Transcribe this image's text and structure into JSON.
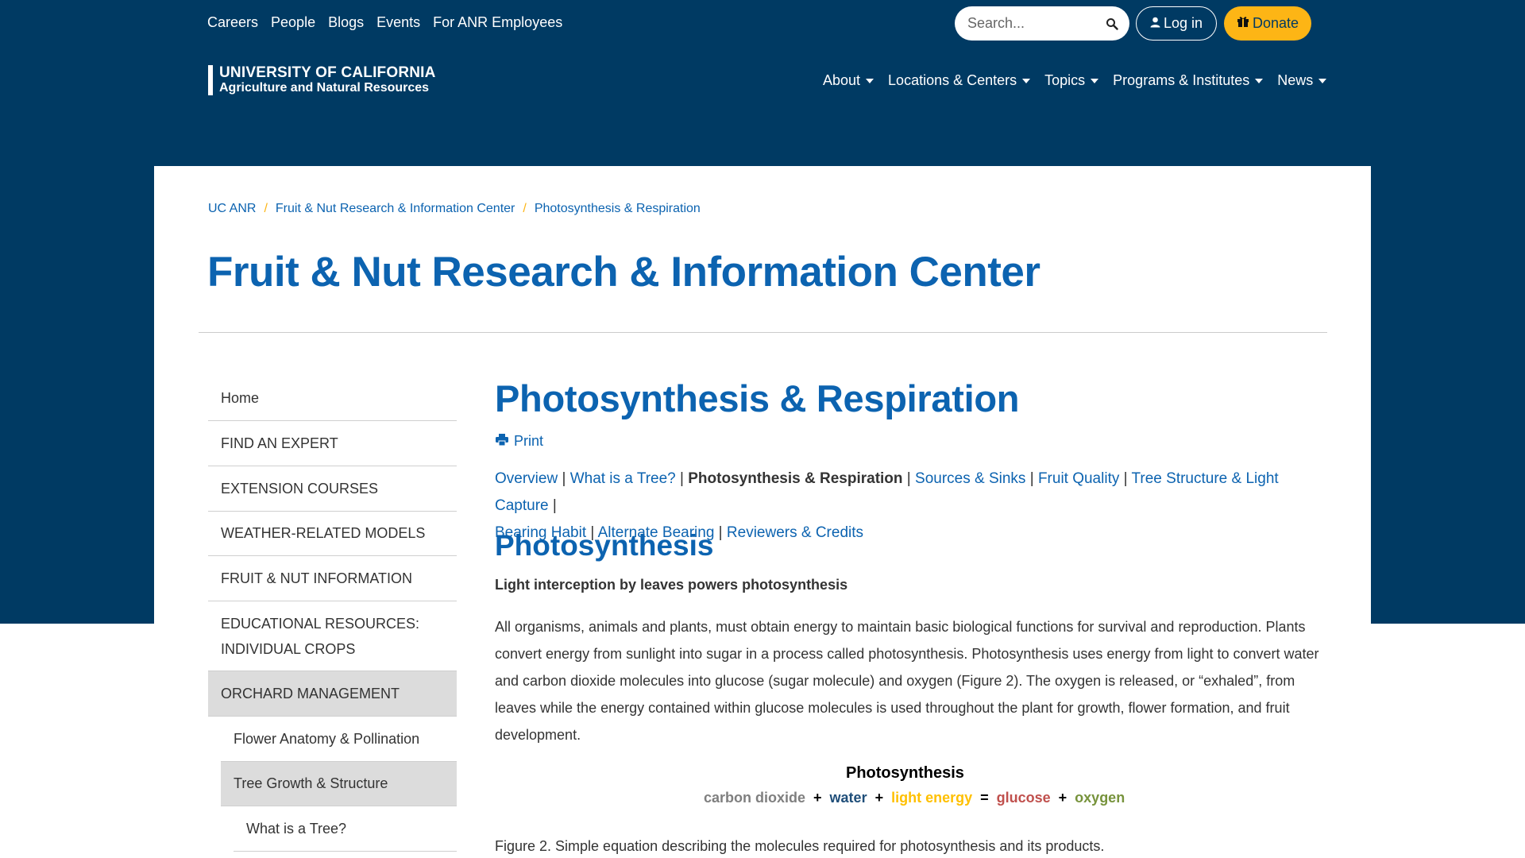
{
  "header": {
    "utility_links": [
      "Careers",
      "People",
      "Blogs",
      "Events",
      "For ANR Employees"
    ],
    "search_placeholder": "Search...",
    "login_label": "Log in",
    "donate_label": "Donate",
    "logo_line1": "UNIVERSITY OF CALIFORNIA",
    "logo_line2": "Agriculture and Natural Resources",
    "main_nav": [
      "About",
      "Locations & Centers",
      "Topics",
      "Programs & Institutes",
      "News"
    ]
  },
  "breadcrumb": [
    "UC ANR",
    "Fruit & Nut Research & Information Center",
    "Photosynthesis & Respiration"
  ],
  "center_title": "Fruit & Nut Research & Information Center",
  "sidebar": {
    "items": [
      {
        "label": "Home",
        "level": 0,
        "active": false
      },
      {
        "label": "FIND AN EXPERT",
        "level": 0,
        "active": false
      },
      {
        "label": "EXTENSION COURSES",
        "level": 0,
        "active": false
      },
      {
        "label": "WEATHER-RELATED MODELS",
        "level": 0,
        "active": false
      },
      {
        "label": "FRUIT & NUT INFORMATION",
        "level": 0,
        "active": false
      },
      {
        "label": "EDUCATIONAL RESOURCES: INDIVIDUAL CROPS",
        "level": 0,
        "active": false
      },
      {
        "label": "ORCHARD MANAGEMENT",
        "level": 0,
        "active": true
      },
      {
        "label": "Flower Anatomy & Pollination",
        "level": 1,
        "active": false
      },
      {
        "label": "Tree Growth & Structure",
        "level": 1,
        "active": true
      },
      {
        "label": "What is a Tree?",
        "level": 2,
        "active": false
      }
    ]
  },
  "main": {
    "page_title": "Photosynthesis & Respiration",
    "print_label": "Print",
    "subnav": {
      "overview": "Overview",
      "what_is_tree": "What is a Tree?",
      "current": "Photosynthesis & Respiration",
      "sources_sinks": "Sources & Sinks",
      "fruit_quality": "Fruit Quality",
      "tree_structure": "Tree Structure & Light Capture",
      "bearing_habit": "Bearing Habit",
      "alternate_bearing": "Alternate Bearing",
      "reviewers": "Reviewers & Credits"
    },
    "section_heading": "Photosynthesis",
    "subheading": "Light interception by leaves powers photosynthesis",
    "paragraph": "All organisms, animals and plants, must obtain energy to maintain basic biological functions for survival and reproduction. Plants convert energy from sunlight into sugar in a process called photosynthesis. Photosynthesis uses energy from light to convert water and carbon dioxide molecules into glucose (sugar molecule) and oxygen (Figure 2). The oxygen is released, or “exhaled”, from leaves while the energy contained within glucose molecules is used throughout the plant for growth, flower formation, and fruit development.",
    "equation": {
      "title": "Photosynthesis",
      "carbon_dioxide": "carbon dioxide",
      "water": "water",
      "light_energy": "light energy",
      "glucose": "glucose",
      "oxygen": "oxygen",
      "plus": "+",
      "equals": "="
    },
    "caption": "Figure 2. Simple equation describing the molecules required for photosynthesis and its products."
  },
  "colors": {
    "navy": "#003a63",
    "link_blue": "#0c63b0",
    "gold": "#fdb515",
    "carbon_dioxide": "#7f7f7f",
    "water": "#1f4e79",
    "light_energy": "#ffc000",
    "glucose": "#c0504d",
    "oxygen": "#77933c"
  },
  "icons": [
    "search-icon",
    "user-icon",
    "gift-icon",
    "caret-down-icon",
    "printer-icon"
  ]
}
